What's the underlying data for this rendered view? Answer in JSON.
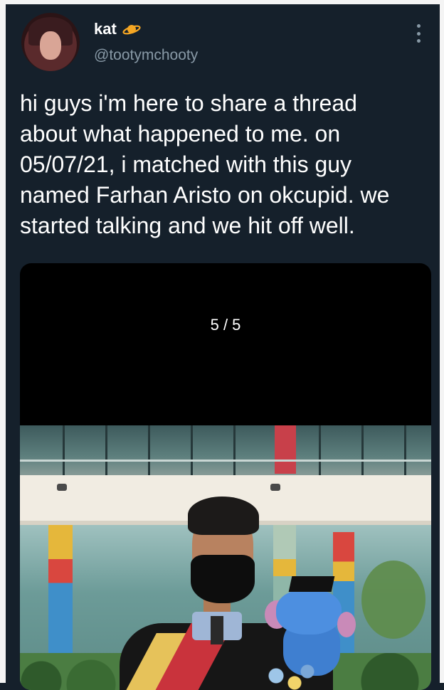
{
  "tweet": {
    "display_name": "kat",
    "name_icon": "planet-icon",
    "handle": "@tootymchooty",
    "more_icon": "more-vertical-icon",
    "text": "hi guys i'm here to share a thread\nabout what happened to me. on\n05/07/21, i matched with this guy\nnamed Farhan Aristo on okcupid. we\nstarted talking and we hit off well."
  },
  "media": {
    "counter": "5 / 5",
    "description_icon": "photo"
  },
  "colors": {
    "background": "#15202b",
    "secondary_text": "#8899a6",
    "planet": "#f5a623"
  }
}
